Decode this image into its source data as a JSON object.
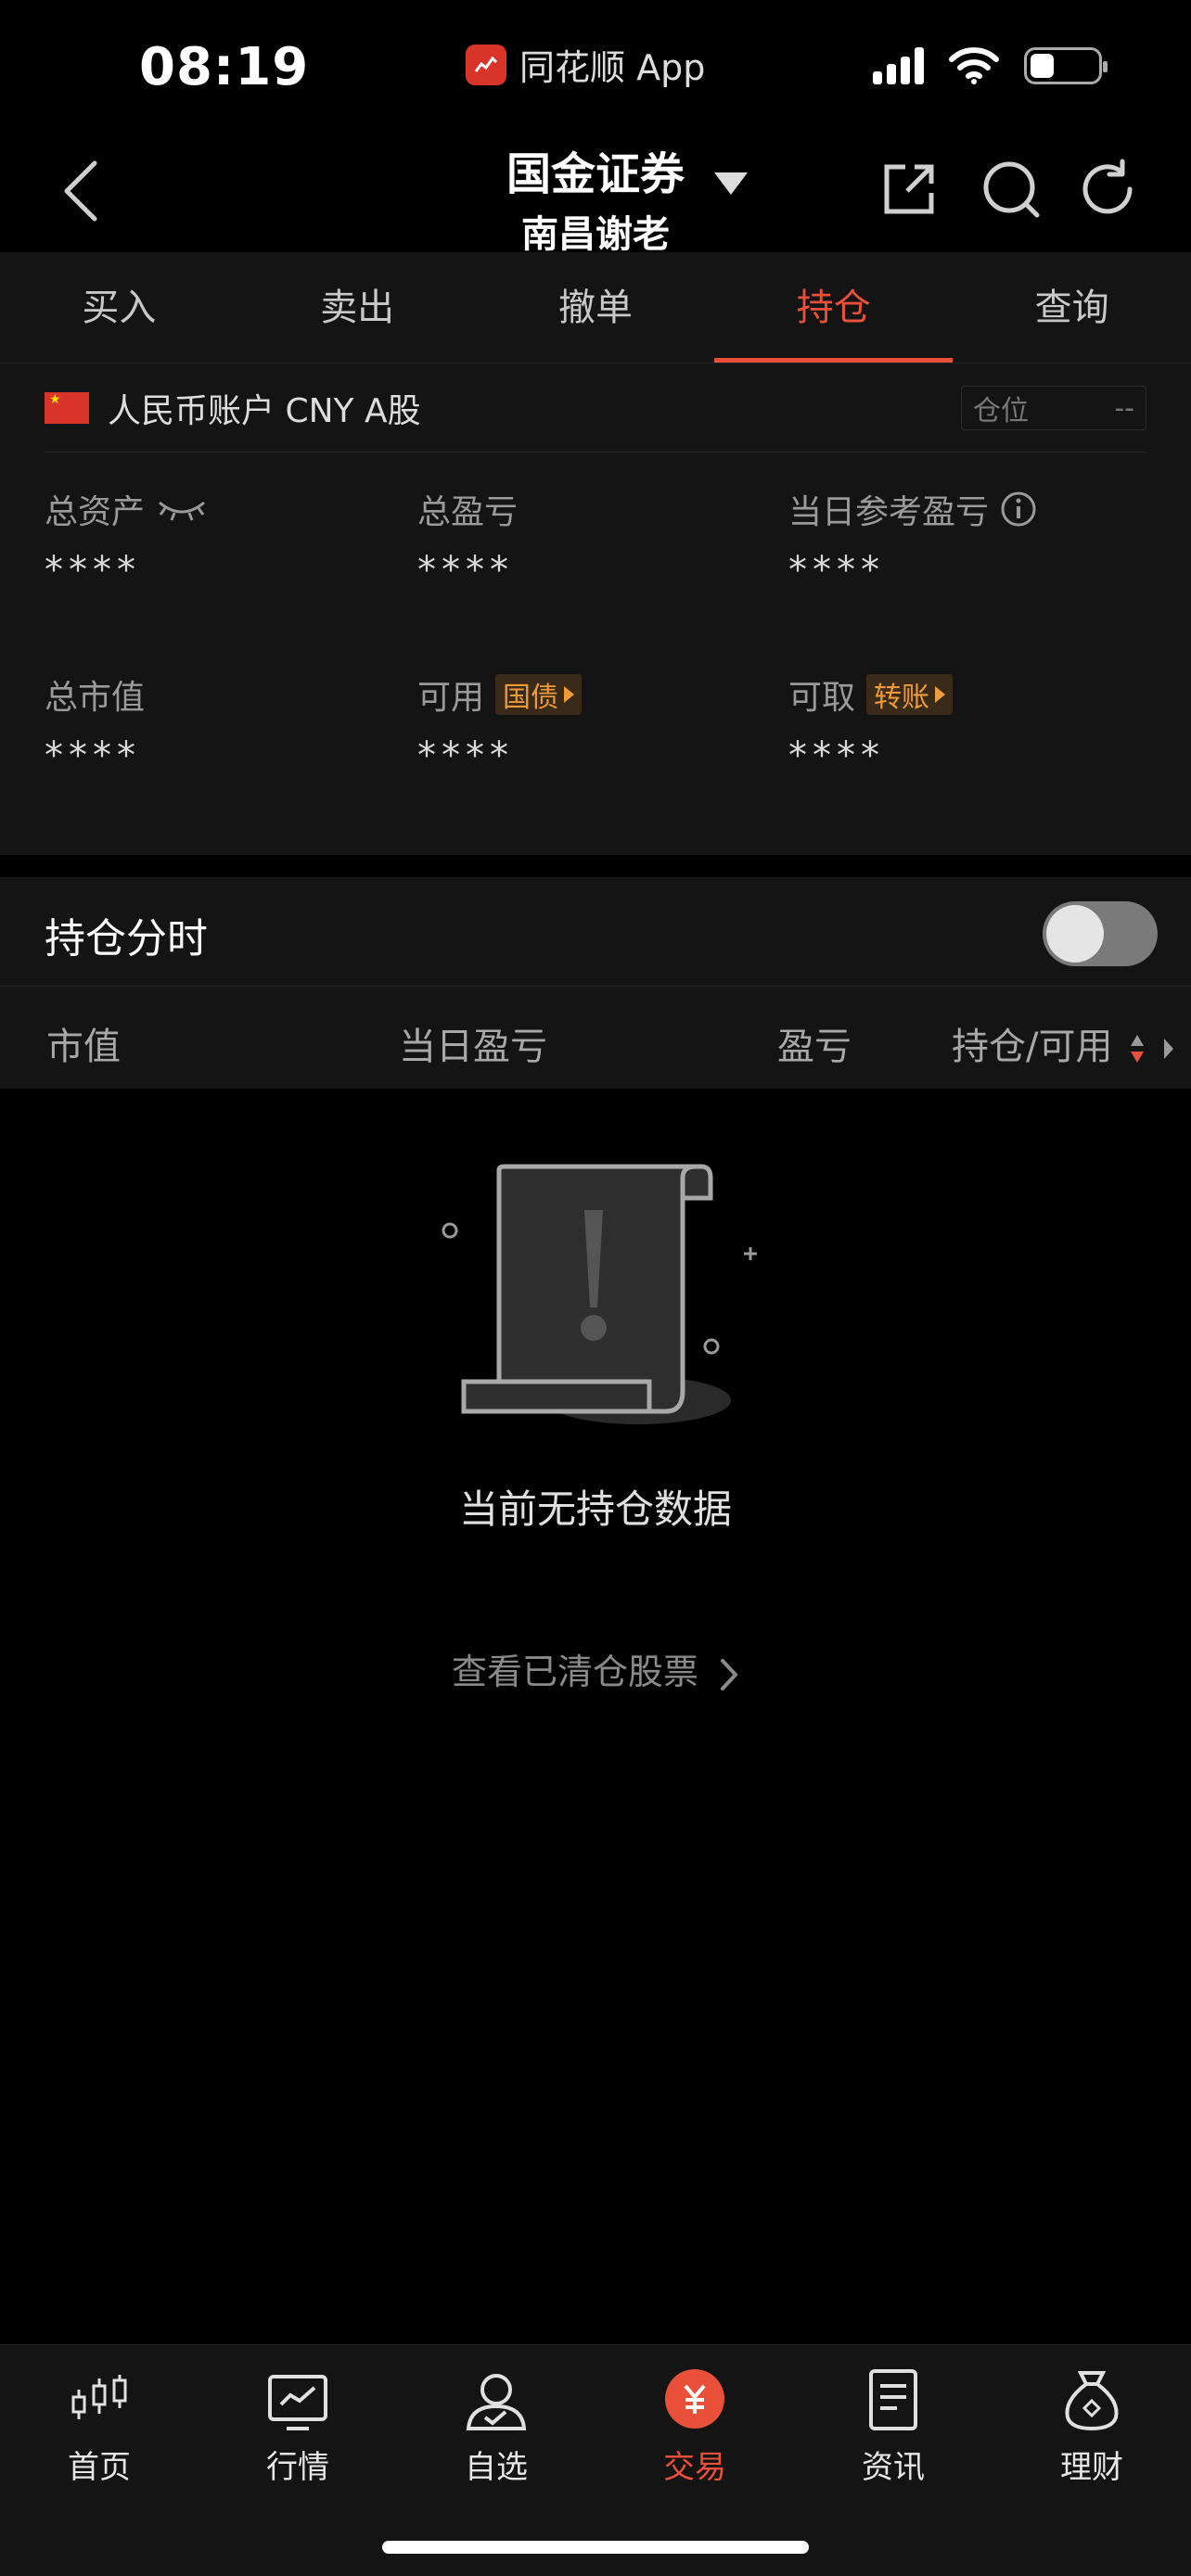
{
  "status_bar": {
    "time": "08:19",
    "app_name": "同花顺 App",
    "battery_level": 0.35
  },
  "header": {
    "title": "国金证券",
    "subtitle": "南昌谢老"
  },
  "tabs": [
    {
      "label": "买入",
      "active": false
    },
    {
      "label": "卖出",
      "active": false
    },
    {
      "label": "撤单",
      "active": false
    },
    {
      "label": "持仓",
      "active": true
    },
    {
      "label": "查询",
      "active": false
    }
  ],
  "account": {
    "label": "人民币账户 CNY A股",
    "position_label": "仓位",
    "position_value": "--"
  },
  "stats": {
    "total_assets": {
      "label": "总资产",
      "value": "****"
    },
    "total_pnl": {
      "label": "总盈亏",
      "value": "****"
    },
    "daily_pnl": {
      "label": "当日参考盈亏",
      "value": "****"
    },
    "market_value": {
      "label": "总市值",
      "value": "****"
    },
    "available": {
      "label": "可用",
      "value": "****",
      "tag": "国债"
    },
    "withdrawable": {
      "label": "可取",
      "value": "****",
      "tag": "转账"
    }
  },
  "holdings": {
    "title": "持仓分时",
    "toggle_on": false
  },
  "columns": {
    "market_value": "市值",
    "daily_pnl": "当日盈亏",
    "pnl": "盈亏",
    "position_available": "持仓/可用"
  },
  "empty_state": {
    "message": "当前无持仓数据",
    "link": "查看已清仓股票"
  },
  "bottom_nav": [
    {
      "label": "首页",
      "icon": "candlestick-icon",
      "active": false
    },
    {
      "label": "行情",
      "icon": "chart-icon",
      "active": false
    },
    {
      "label": "自选",
      "icon": "user-icon",
      "active": false
    },
    {
      "label": "交易",
      "icon": "yuan-icon",
      "active": true
    },
    {
      "label": "资讯",
      "icon": "document-icon",
      "active": false
    },
    {
      "label": "理财",
      "icon": "money-bag-icon",
      "active": false
    }
  ],
  "colors": {
    "accent": "#e8503a",
    "tag": "#f09a3a",
    "panel": "#141414"
  }
}
